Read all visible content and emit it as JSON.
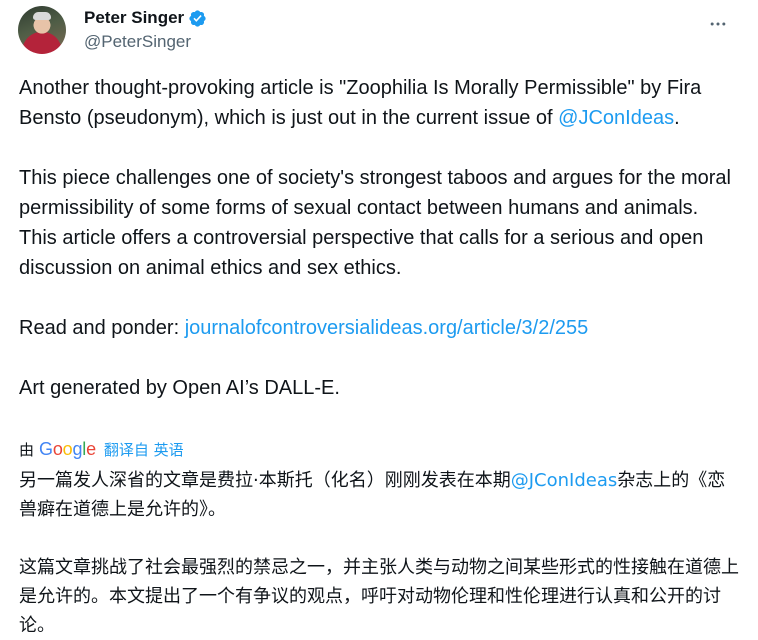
{
  "author": {
    "display_name": "Peter Singer",
    "handle": "@PeterSinger",
    "verified": true,
    "avatar_description_icon": "profile-photo"
  },
  "colors": {
    "link": "#1d9bf0",
    "text": "#0f1419",
    "secondary": "#536471",
    "google_blue": "#4285F4",
    "google_red": "#EA4335",
    "google_yellow": "#FBBC05",
    "google_green": "#34A853"
  },
  "icons": {
    "verified": "verified-badge-icon",
    "more": "more-options-icon"
  },
  "tweet": {
    "p1_before": "Another thought-provoking article is \"Zoophilia Is Morally Permissible\" by Fira Bensto (pseudonym), which is just out in the current issue of ",
    "p1_mention": "@JConIdeas",
    "p1_after": ".",
    "p2": "This piece challenges one of society's strongest taboos and argues for the moral permissibility of some forms of sexual contact between humans and animals. This article offers a controversial perspective that calls for a serious and open discussion on animal ethics and sex ethics.",
    "p3_label": "Read and ponder: ",
    "p3_link": "journalofcontroversialideas.org/article/3/2/255",
    "p4": "Art generated by Open AI’s DALL-E."
  },
  "translation": {
    "by": "由",
    "google": [
      "G",
      "o",
      "o",
      "g",
      "l",
      "e"
    ],
    "translated_from": "翻译自 英语",
    "zh_p1_before": "另一篇发人深省的文章是费拉·本斯托（化名）刚刚发表在本期",
    "zh_p1_mention": "@JConIdeas",
    "zh_p1_after": "杂志上的《恋兽癖在道德上是允许的》。",
    "zh_p2": "这篇文章挑战了社会最强烈的禁忌之一，并主张人类与动物之间某些形式的性接触在道德上是允许的。本文提出了一个有争议的观点，呼吁对动物伦理和性伦理进行认真和公开的讨论。"
  }
}
